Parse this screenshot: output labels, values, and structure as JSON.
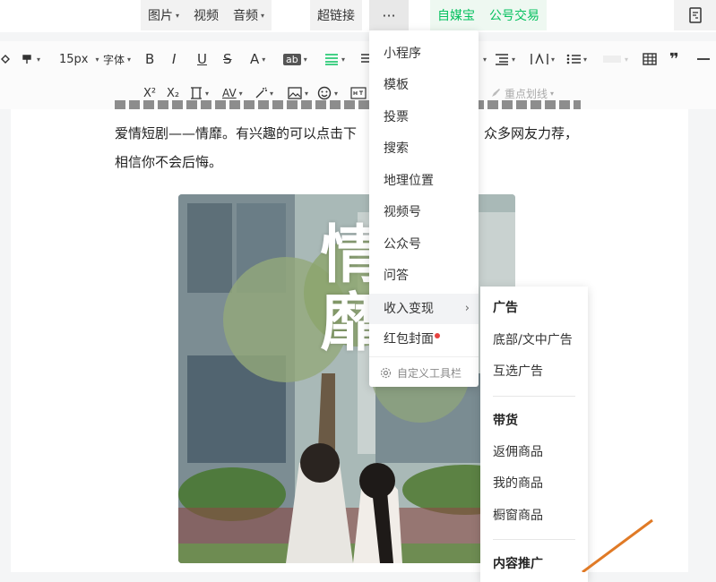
{
  "topbar": {
    "image": "图片",
    "video": "视频",
    "audio": "音频",
    "hyperlink": "超链接",
    "more": "···",
    "self_media": "自媒宝",
    "account_trade": "公号交易"
  },
  "format_row1": {
    "font_size": "15px",
    "font": "字体",
    "bold": "B",
    "italic": "I",
    "underline": "U",
    "strike": "S",
    "font_color": "A",
    "bg_color": "ab"
  },
  "format_row2": {
    "superscript": "X²",
    "subscript": "X₂",
    "letter_spacing": "AV",
    "highlight": "重点划线"
  },
  "content": {
    "line2": "爱情短剧——情靡。有兴趣的可以点击下",
    "line2_right": "众多网友力荐，",
    "line3": "相信你不会后悔。"
  },
  "photo": {
    "calligraphy": "情靡"
  },
  "more_menu": {
    "items": [
      "小程序",
      "模板",
      "投票",
      "搜索",
      "地理位置",
      "视频号",
      "公众号",
      "问答",
      "收入变现",
      "红包封面"
    ],
    "custom_toolbar": "自定义工具栏"
  },
  "sub_menu": {
    "ad_header": "广告",
    "ad_items": [
      "底部/文中广告",
      "互选广告"
    ],
    "goods_header": "带货",
    "goods_items": [
      "返佣商品",
      "我的商品",
      "橱窗商品"
    ],
    "promo_header": "内容推广"
  },
  "colors": {
    "accent": "#07c160",
    "red_dot": "#e64340"
  }
}
